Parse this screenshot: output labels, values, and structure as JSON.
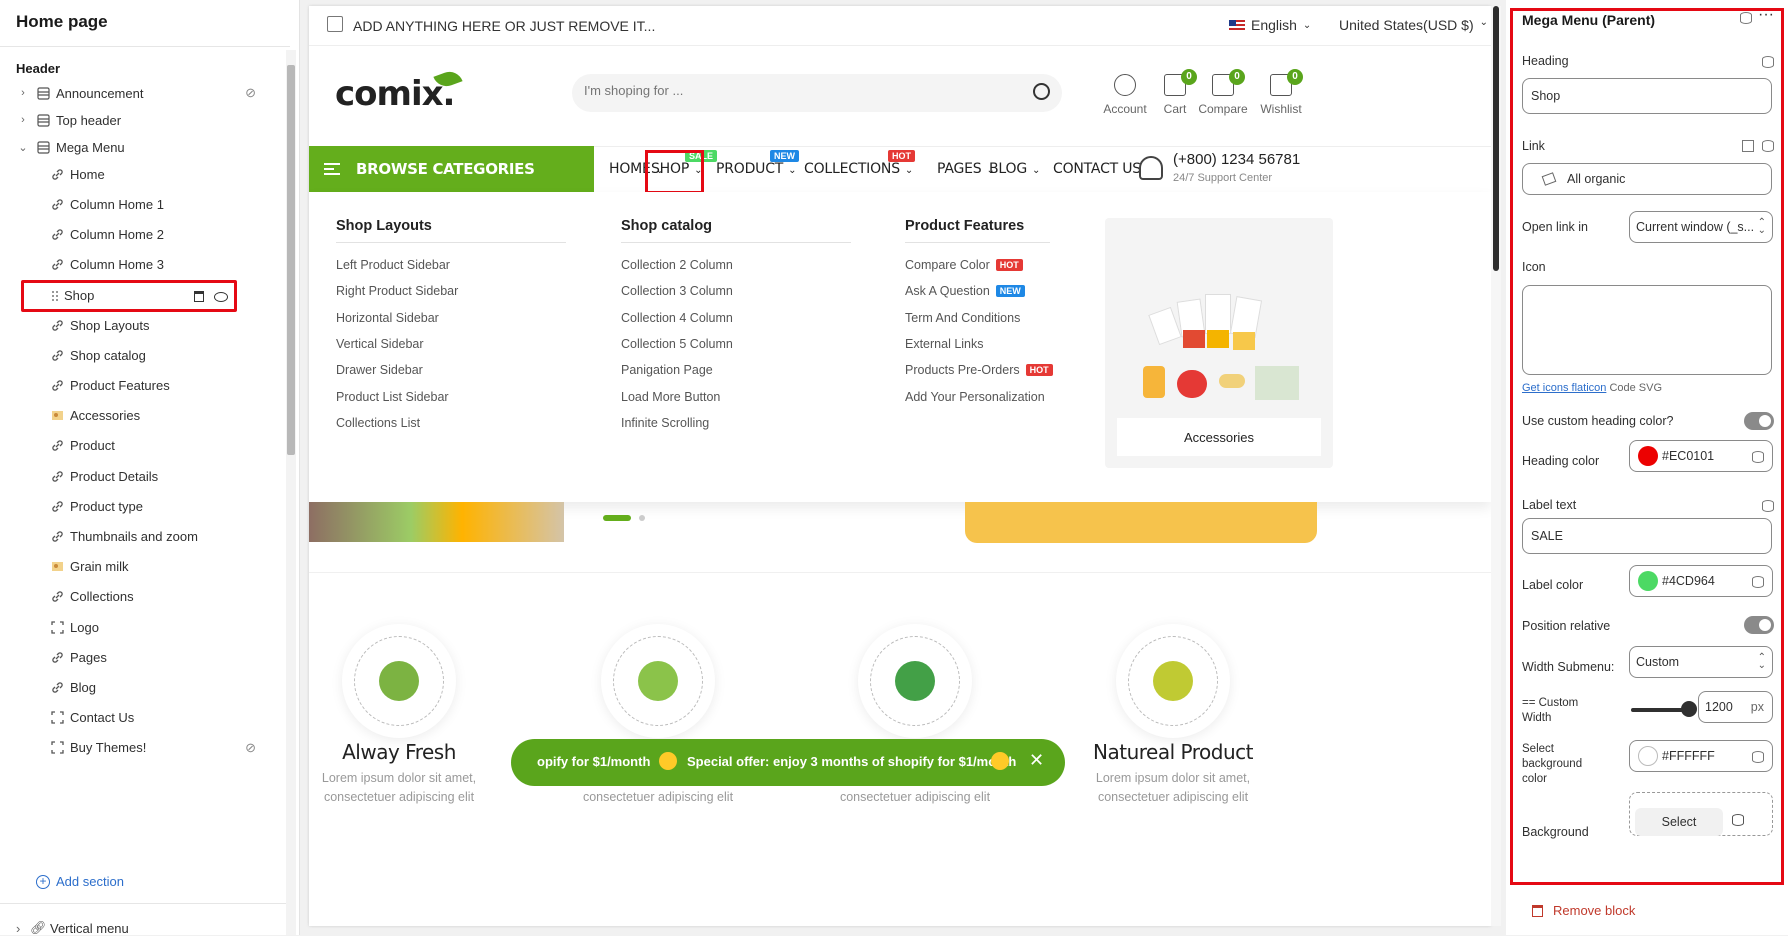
{
  "left_panel": {
    "title": "Home page",
    "section": "Header",
    "items": [
      {
        "label": "Announcement",
        "icon": "layout-icon",
        "chevron": "›",
        "hidden": true
      },
      {
        "label": "Top header",
        "icon": "layout-icon",
        "chevron": "›"
      },
      {
        "label": "Mega Menu",
        "icon": "layout-icon",
        "chevron": "⌄"
      },
      {
        "label": "Home",
        "icon": "link-icon"
      },
      {
        "label": "Column Home 1",
        "icon": "link-icon"
      },
      {
        "label": "Column Home 2",
        "icon": "link-icon"
      },
      {
        "label": "Column Home 3",
        "icon": "link-icon"
      },
      {
        "label": "Shop",
        "icon": "drag-handle-icon",
        "selected": true
      },
      {
        "label": "Shop Layouts",
        "icon": "link-icon"
      },
      {
        "label": "Shop catalog",
        "icon": "link-icon"
      },
      {
        "label": "Product Features",
        "icon": "link-icon"
      },
      {
        "label": "Accessories",
        "icon": "image-icon"
      },
      {
        "label": "Product",
        "icon": "link-icon"
      },
      {
        "label": "Product Details",
        "icon": "link-icon"
      },
      {
        "label": "Product type",
        "icon": "link-icon"
      },
      {
        "label": "Thumbnails and zoom",
        "icon": "link-icon"
      },
      {
        "label": "Grain milk",
        "icon": "image-icon"
      },
      {
        "label": "Collections",
        "icon": "link-icon"
      },
      {
        "label": "Logo",
        "icon": "frame-icon"
      },
      {
        "label": "Pages",
        "icon": "link-icon"
      },
      {
        "label": "Blog",
        "icon": "link-icon"
      },
      {
        "label": "Contact Us",
        "icon": "frame-icon"
      },
      {
        "label": "Buy Themes!",
        "icon": "frame-icon",
        "hidden": true
      }
    ],
    "add_section": "Add section",
    "vertical_menu": "Vertical menu"
  },
  "store": {
    "announcement": "ADD ANYTHING HERE OR JUST REMOVE IT...",
    "language": "English",
    "currency": "United States(USD $)",
    "logo_text": "comix.",
    "search_placeholder": "I'm shoping for ...",
    "header_icons": [
      {
        "label": "Account",
        "icon": "account-icon"
      },
      {
        "label": "Cart",
        "icon": "cart-icon",
        "count": "0"
      },
      {
        "label": "Compare",
        "icon": "compare-icon",
        "count": "0"
      },
      {
        "label": "Wishlist",
        "icon": "wishlist-icon",
        "count": "0"
      }
    ],
    "browse": "BROWSE CATEGORIES",
    "nav": [
      {
        "label": "HOME"
      },
      {
        "label": "SHOP",
        "badge": "SALE",
        "badge_color": "#4CD964"
      },
      {
        "label": "PRODUCT",
        "badge": "NEW",
        "badge_color": "#1E88E5"
      },
      {
        "label": "COLLECTIONS",
        "badge": "HOT",
        "badge_color": "#E53935"
      },
      {
        "label": "PAGES"
      },
      {
        "label": "BLOG"
      },
      {
        "label": "CONTACT US"
      }
    ],
    "phone": "(+800) 1234 56781",
    "support": "24/7 Support Center",
    "mega": {
      "columns": [
        {
          "heading": "Shop Layouts",
          "links": [
            {
              "label": "Left Product Sidebar"
            },
            {
              "label": "Right Product Sidebar"
            },
            {
              "label": "Horizontal Sidebar"
            },
            {
              "label": "Vertical Sidebar"
            },
            {
              "label": "Drawer Sidebar"
            },
            {
              "label": "Product List Sidebar"
            },
            {
              "label": "Collections List"
            }
          ]
        },
        {
          "heading": "Shop catalog",
          "links": [
            {
              "label": "Collection 2 Column"
            },
            {
              "label": "Collection 3 Column"
            },
            {
              "label": "Collection 4 Column"
            },
            {
              "label": "Collection 5 Column"
            },
            {
              "label": "Panigation Page"
            },
            {
              "label": "Load More Button"
            },
            {
              "label": "Infinite Scrolling"
            }
          ]
        },
        {
          "heading": "Product Features",
          "links": [
            {
              "label": "Compare Color",
              "badge": "HOT"
            },
            {
              "label": "Ask A Question",
              "badge": "NEW"
            },
            {
              "label": "Term And Conditions"
            },
            {
              "label": "External Links"
            },
            {
              "label": "Products Pre-Orders",
              "badge": "HOT"
            },
            {
              "label": "Add Your Personalization"
            }
          ]
        }
      ],
      "promo_label": "Accessories"
    },
    "features": [
      {
        "title": "Alway Fresh",
        "text1": "Lorem ipsum dolor sit amet,",
        "text2": "consectetuer adipiscing elit",
        "icon": "vegetables-icon"
      },
      {
        "title": "",
        "text1": "",
        "text2": "consectetuer adipiscing elit",
        "icon": "100-percent-icon"
      },
      {
        "title": "",
        "text1": "",
        "text2": "consectetuer adipiscing elit",
        "icon": "leaf-recycle-icon"
      },
      {
        "title": "Natureal Product",
        "text1": "Lorem ipsum dolor sit amet,",
        "text2": "consectetuer adipiscing elit",
        "icon": "natural-badge-icon"
      }
    ],
    "offer_left": "opify for $1/month",
    "offer_main": "Special offer: enjoy 3 months of shopify for $1/month"
  },
  "right_panel": {
    "title": "Mega Menu (Parent)",
    "heading_label": "Heading",
    "heading_value": "Shop",
    "link_label": "Link",
    "link_value": "All organic",
    "open_label": "Open link in",
    "open_value": "Current window (_s...",
    "icon_label": "Icon",
    "icons_link": "Get icons flaticon",
    "icons_suffix": "Code SVG",
    "custom_heading_label": "Use custom heading color?",
    "heading_color_label": "Heading color",
    "heading_color": "#EC0101",
    "label_text_label": "Label text",
    "label_text_value": "SALE",
    "label_color_label": "Label color",
    "label_color": "#4CD964",
    "position_label": "Position relative",
    "width_label": "Width Submenu:",
    "width_value": "Custom",
    "custom_width_label1": "== Custom",
    "custom_width_label2": "Width",
    "custom_width_value": "1200",
    "custom_width_unit": "px",
    "custom_width_fraction": 0.72,
    "bg_label1": "Select",
    "bg_label2": "background",
    "bg_label3": "color",
    "bg_color": "#FFFFFF",
    "background_label": "Background",
    "select_btn": "Select",
    "remove": "Remove block"
  }
}
